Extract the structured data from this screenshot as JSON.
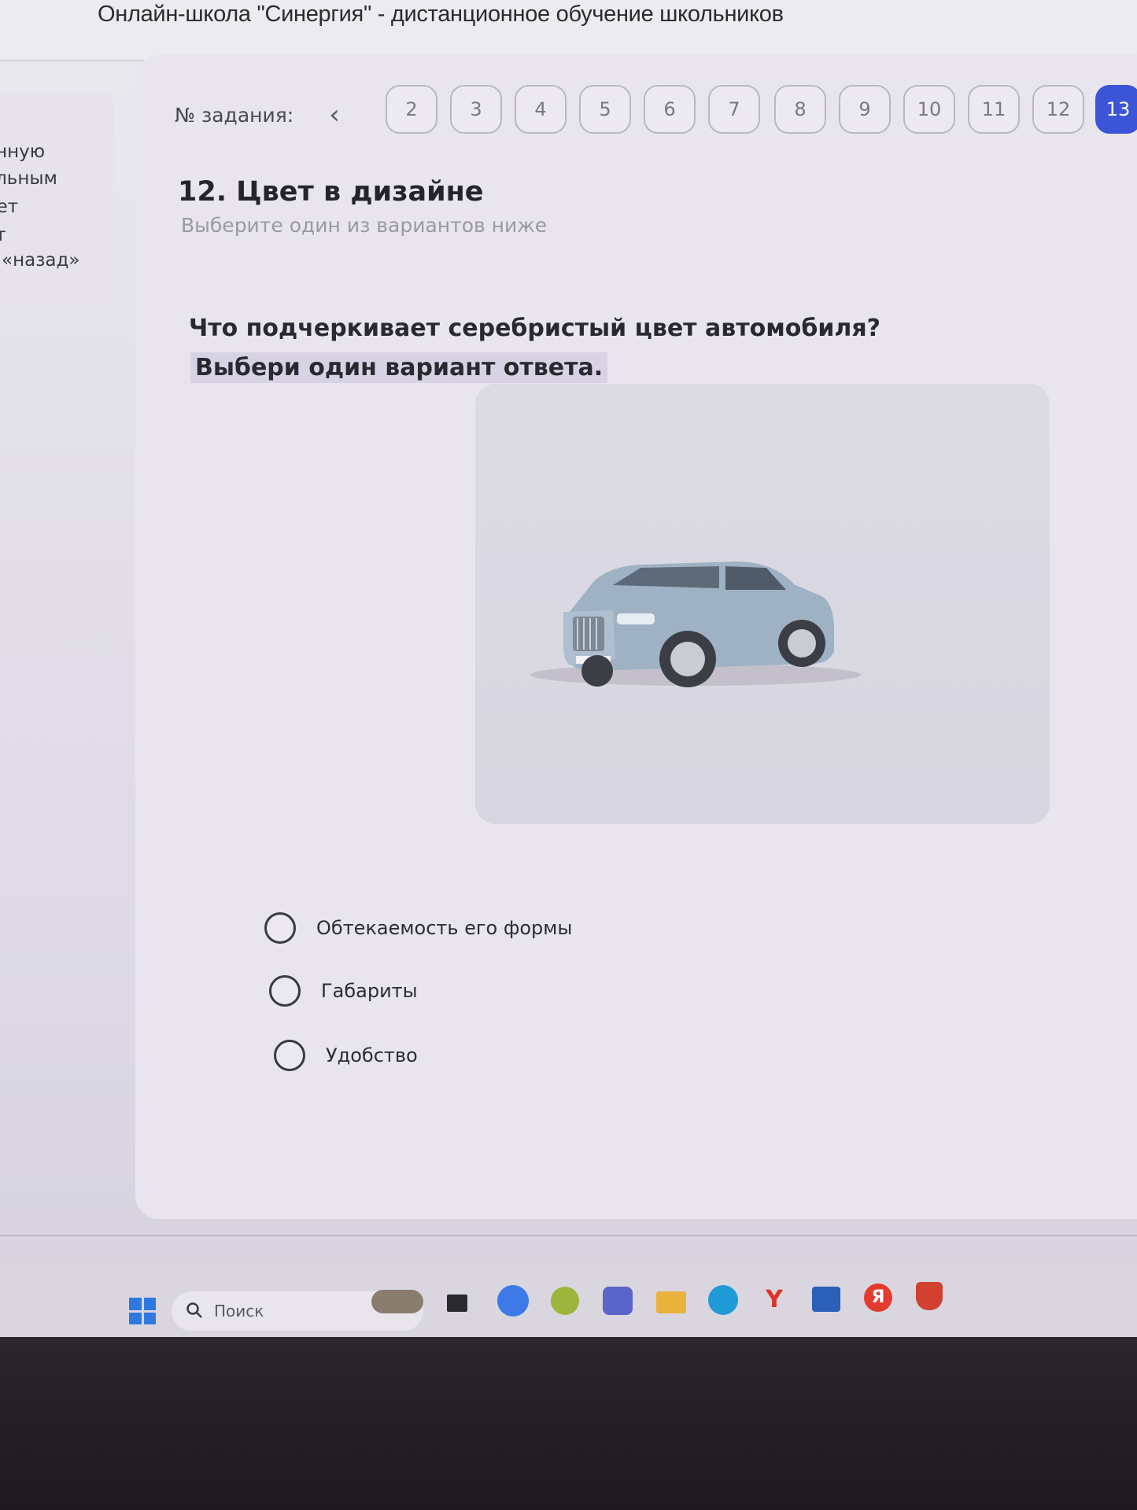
{
  "window": {
    "title": "Онлайн-школа \"Синергия\" - дистанционное обучение школьников"
  },
  "left_panel": {
    "lines": [
      "онную",
      "альным",
      "цет",
      "ет",
      "«назад»"
    ]
  },
  "task_nav": {
    "label": "№ задания:",
    "numbers": [
      "2",
      "3",
      "4",
      "5",
      "6",
      "7",
      "8",
      "9",
      "10",
      "11",
      "12",
      "13"
    ],
    "active": "13"
  },
  "section": {
    "title": "12. Цвет в дизайне",
    "subtitle": "Выберите один из вариантов ниже"
  },
  "question": {
    "text": "Что подчеркивает серебристый цвет автомобиля?",
    "instruction": "Выбери один вариант ответа."
  },
  "options": [
    {
      "label": "Обтекаемость его формы",
      "selected": false
    },
    {
      "label": "Габариты",
      "selected": false
    },
    {
      "label": "Удобство",
      "selected": false
    }
  ],
  "taskbar": {
    "search_placeholder": "Поиск",
    "icons": [
      "windows-start-icon",
      "widgets-icon",
      "task-view-icon",
      "zoom-icon",
      "plus-app-icon",
      "teams-icon",
      "file-explorer-icon",
      "edge-icon",
      "yandex-browser-icon",
      "store-icon",
      "yandex-icon",
      "shield-app-icon"
    ]
  },
  "colors": {
    "accent": "#3c55d6",
    "background": "#e2dfe9"
  }
}
